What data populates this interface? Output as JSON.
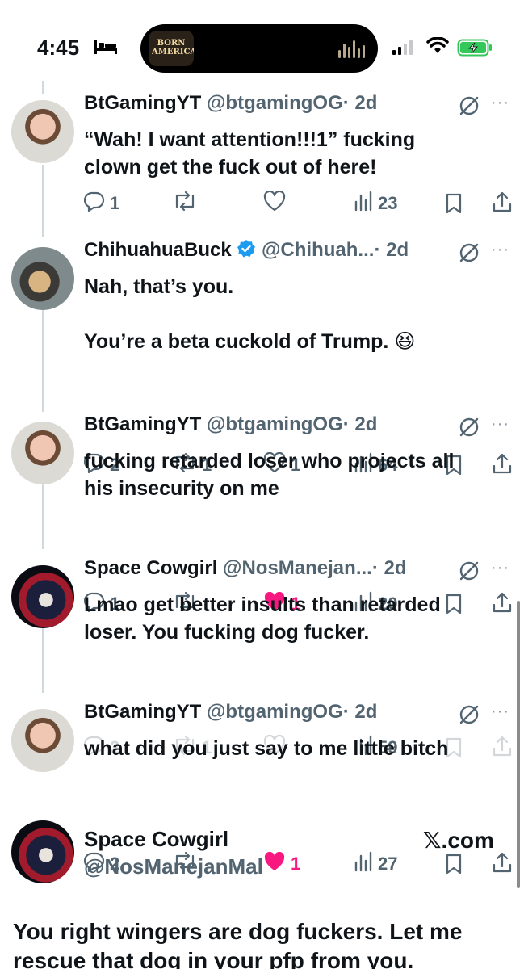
{
  "status_bar": {
    "time": "4:45",
    "island_art_text": "BORN AMERICAN"
  },
  "tweets": [
    {
      "id": "t1",
      "name": "BtGamingYT",
      "handle": "@btgamingOG",
      "time": "· 2d",
      "verified": false,
      "avatar": "BtGamingYT avatar",
      "text": "“Wah! I want attention!!!1” fucking\nclown get the fuck out of here!",
      "replies": "1",
      "reposts": "",
      "likes": "",
      "liked": false,
      "views": "23",
      "faded": false
    },
    {
      "id": "t2",
      "name": "ChihuahuaBuck",
      "handle": "@Chihuah...",
      "time": "· 2d",
      "verified": true,
      "avatar": "ChihuahuaBuck avatar",
      "text": "Nah, that’s you.\n\nYou’re a beta cuckold of Trump. 😆",
      "replies": "2",
      "reposts": "1",
      "likes": "1",
      "liked": false,
      "views": "64",
      "faded": false
    },
    {
      "id": "t3",
      "name": "BtGamingYT",
      "handle": "@btgamingOG",
      "time": "· 2d",
      "verified": false,
      "avatar": "BtGamingYT avatar",
      "text": "fucking retarded loser who projects all\nhis insecurity on me",
      "replies": "1",
      "reposts": "",
      "likes": "1",
      "liked": true,
      "views": "20",
      "faded": false
    },
    {
      "id": "t4",
      "name": "Space Cowgirl",
      "handle": "@NosManejan...",
      "time": "· 2d",
      "verified": false,
      "avatar": "Space Cowgirl avatar",
      "text": "Lmao get better insults than retarded\nloser. You fucking dog fucker.",
      "replies": "2",
      "reposts": "1",
      "likes": "",
      "liked": false,
      "views": "59",
      "faded": true
    },
    {
      "id": "t5",
      "name": "BtGamingYT",
      "handle": "@btgamingOG",
      "time": "· 2d",
      "verified": false,
      "avatar": "BtGamingYT avatar",
      "text": "what did you just say to me little bitch",
      "replies": "2",
      "reposts": "",
      "likes": "1",
      "liked": true,
      "views": "27",
      "faded": false
    }
  ],
  "card": {
    "name": "Space Cowgirl",
    "handle": "@NosManejanMal",
    "watermark": "𝕏.com",
    "text": "You right wingers are dog fuckers. Let me\nrescue that dog in your pfp from you."
  },
  "colors": {
    "text": "#0f1419",
    "secondary": "#536471",
    "like_pink": "#f91880",
    "verified_blue": "#1d9bf0",
    "thread_line": "#cfd9de",
    "battery_green": "#34c759"
  },
  "icons": [
    "bed-icon",
    "signal-icon",
    "wifi-icon",
    "battery-icon",
    "verified-icon",
    "grok-icon",
    "more-icon",
    "reply-icon",
    "repost-icon",
    "like-icon",
    "views-icon",
    "bookmark-icon",
    "share-icon"
  ]
}
